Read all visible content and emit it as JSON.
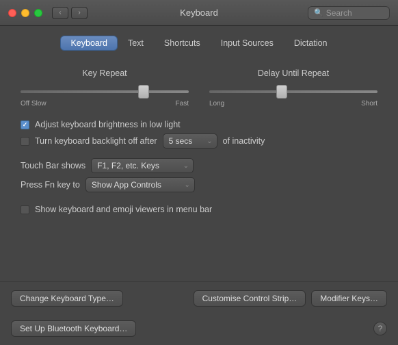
{
  "titlebar": {
    "title": "Keyboard",
    "search_placeholder": "Search"
  },
  "tabs": [
    {
      "id": "keyboard",
      "label": "Keyboard",
      "active": true
    },
    {
      "id": "text",
      "label": "Text",
      "active": false
    },
    {
      "id": "shortcuts",
      "label": "Shortcuts",
      "active": false
    },
    {
      "id": "input-sources",
      "label": "Input Sources",
      "active": false
    },
    {
      "id": "dictation",
      "label": "Dictation",
      "active": false
    }
  ],
  "sliders": {
    "key_repeat": {
      "label": "Key Repeat",
      "left_label": "Off",
      "left_label2": "Slow",
      "right_label": "Fast"
    },
    "delay_until_repeat": {
      "label": "Delay Until Repeat",
      "left_label": "Long",
      "right_label": "Short"
    }
  },
  "checkboxes": {
    "brightness": {
      "label": "Adjust keyboard brightness in low light",
      "checked": true
    },
    "backlight": {
      "label": "Turn keyboard backlight off after",
      "checked": false,
      "dropdown_value": "5 secs",
      "suffix": "of inactivity"
    },
    "menu_bar": {
      "label": "Show keyboard and emoji viewers in menu bar",
      "checked": false
    }
  },
  "dropdowns": {
    "touch_bar": {
      "label": "Touch Bar shows",
      "value": "F1, F2, etc. Keys"
    },
    "fn_key": {
      "label": "Press Fn key to",
      "value": "Show App Controls"
    }
  },
  "buttons": {
    "change_keyboard": "Change Keyboard Type…",
    "customise_strip": "Customise Control Strip…",
    "modifier_keys": "Modifier Keys…",
    "bluetooth_keyboard": "Set Up Bluetooth Keyboard…",
    "help": "?"
  }
}
